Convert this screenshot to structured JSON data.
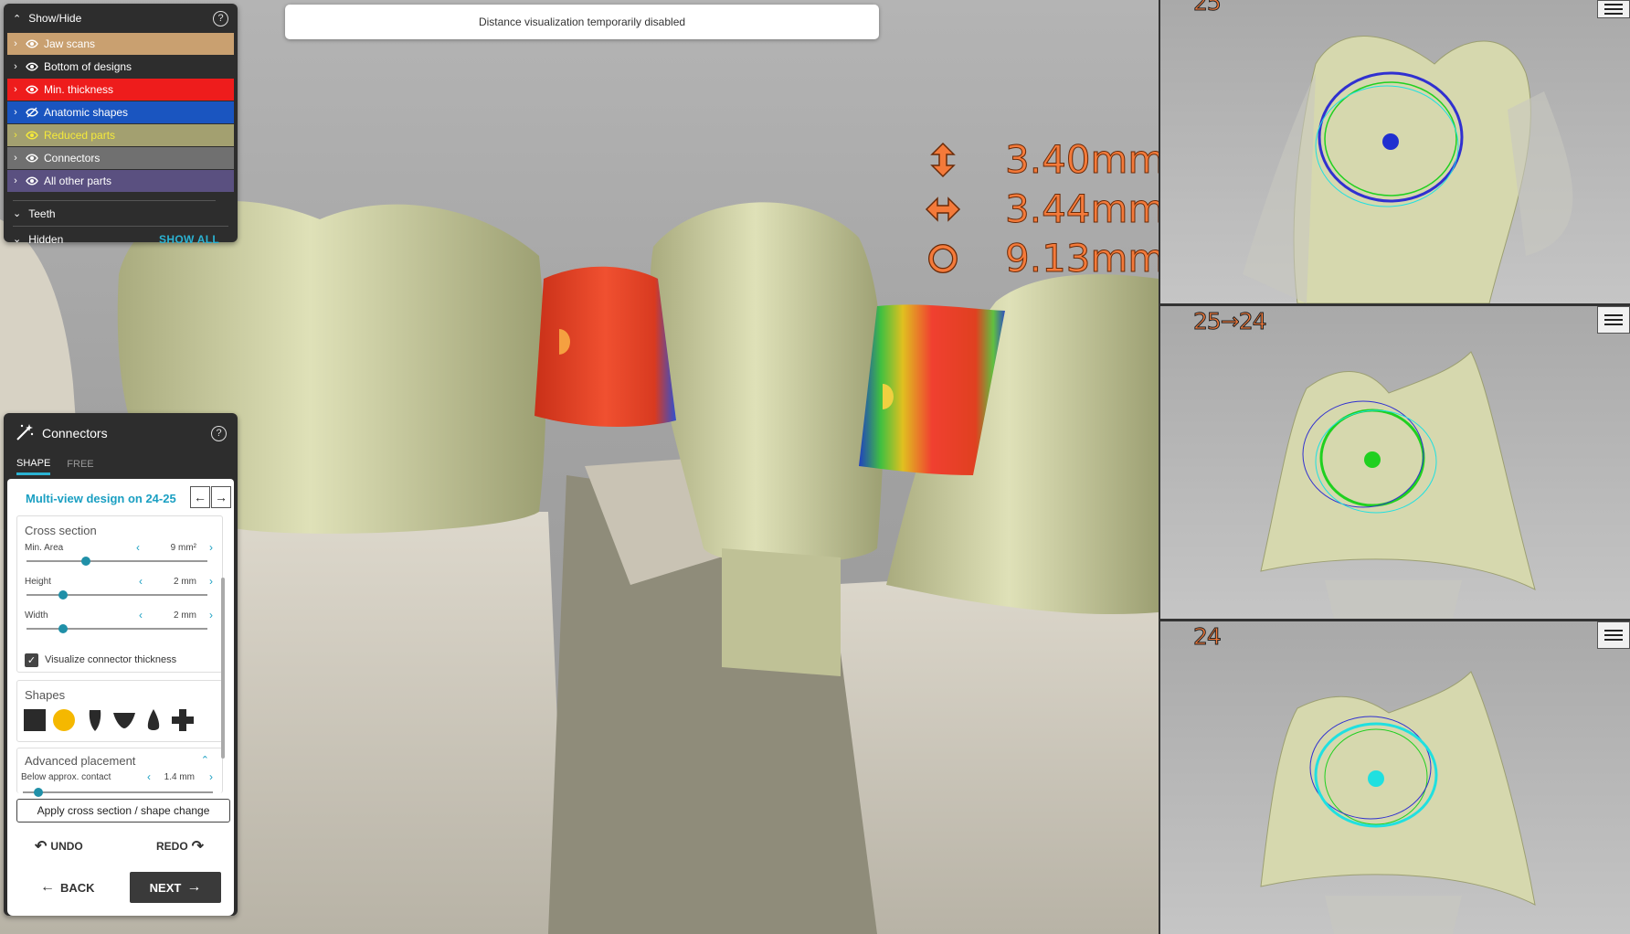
{
  "banner": {
    "text": "Distance visualization temporarily disabled"
  },
  "measurements": [
    {
      "icon": "vertical-arrow-icon",
      "value": "3.40mm"
    },
    {
      "icon": "horizontal-arrow-icon",
      "value": "3.44mm"
    },
    {
      "icon": "circumference-icon",
      "value": "9.13mm"
    }
  ],
  "showhide": {
    "title": "Show/Hide",
    "layers": [
      {
        "label": "Jaw scans",
        "color": "#c9a070",
        "text_color": "#ffffff",
        "visible": true
      },
      {
        "label": "Bottom of designs",
        "color": "#2d2d2d",
        "text_color": "#ffffff",
        "visible": true
      },
      {
        "label": "Min. thickness",
        "color": "#ee1c1c",
        "text_color": "#ffffff",
        "visible": true
      },
      {
        "label": "Anatomic shapes",
        "color": "#1a55c0",
        "text_color": "#ffffff",
        "visible": false
      },
      {
        "label": "Reduced parts",
        "color": "#a3a070",
        "text_color": "#f5ea3a",
        "visible": true
      },
      {
        "label": "Connectors",
        "color": "#707070",
        "text_color": "#ffffff",
        "visible": true
      },
      {
        "label": "All other parts",
        "color": "#5a5080",
        "text_color": "#ffffff",
        "visible": true
      }
    ],
    "teeth_label": "Teeth",
    "hidden_label": "Hidden",
    "show_all": "SHOW ALL"
  },
  "connectors": {
    "title": "Connectors",
    "tabs": [
      {
        "label": "SHAPE",
        "active": true
      },
      {
        "label": "FREE",
        "active": false
      }
    ],
    "multiview": "Multi-view design on 24-25",
    "cross_section": {
      "title": "Cross section",
      "params": [
        {
          "label": "Min. Area",
          "value": "9 mm²",
          "level": 0.33
        },
        {
          "label": "Height",
          "value": "2 mm",
          "level": 0.2
        },
        {
          "label": "Width",
          "value": "2 mm",
          "level": 0.2
        }
      ],
      "visualize_label": "Visualize connector thickness",
      "visualize_checked": true
    },
    "shapes": {
      "title": "Shapes",
      "items": [
        "square-shape-icon",
        "circle-shape-icon",
        "bullet-shape-icon",
        "wedge-shape-icon",
        "drop-shape-icon",
        "cross-shape-icon"
      ],
      "selected": 1
    },
    "advanced": {
      "title": "Advanced placement",
      "param": {
        "label": "Below approx. contact",
        "value": "1.4 mm",
        "level": 0.08
      }
    },
    "apply_label": "Apply cross section / shape change",
    "undo_label": "UNDO",
    "redo_label": "REDO",
    "back_label": "BACK",
    "next_label": "NEXT"
  },
  "views": [
    {
      "label": "25",
      "dot_color": "#1f2fd0"
    },
    {
      "label": "25→24",
      "dot_color": "#20d020"
    },
    {
      "label": "24",
      "dot_color": "#20e0e0"
    }
  ],
  "colors": {
    "accent": "#2bb3d3",
    "measure": "#f47a3a",
    "tooth": "#d6d8ae"
  }
}
